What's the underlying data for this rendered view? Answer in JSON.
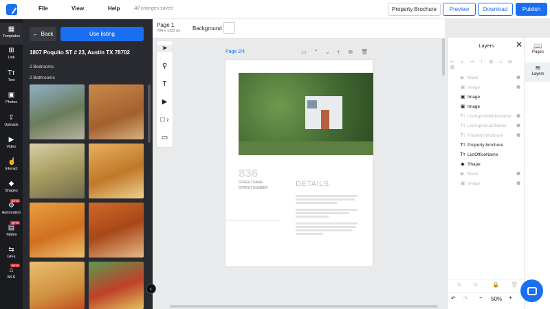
{
  "topbar": {
    "menus": [
      "File",
      "View",
      "Help"
    ],
    "saved": "All changes saved",
    "property_brochure": "Property Brochure",
    "preview": "Preview",
    "download": "Download",
    "publish": "Publish"
  },
  "rail": {
    "items": [
      "Templates",
      "Link",
      "Text",
      "Photos",
      "Uploads",
      "Video",
      "Interact",
      "Shapes",
      "Automation",
      "Tables",
      "GIFs",
      "MLS"
    ],
    "beta": "BETA"
  },
  "panel": {
    "back": "Back",
    "use_listing": "Use listing",
    "address": "1807 Poquito ST # 23, Austin TX 78702",
    "bedrooms": "2 Bedrooms",
    "bathrooms": "2 Bathrooms"
  },
  "subbar": {
    "page": "Page 1",
    "dims": "794 x 1123 px",
    "background": "Background"
  },
  "canvas": {
    "page_label": "Page 2/4",
    "street_number": "836",
    "street_name": "STREET NAME",
    "street_number_label": "STREET NUMBER",
    "details": "DETAILS"
  },
  "layers": {
    "title": "Layers",
    "items": [
      {
        "label": "Mask",
        "icon": "video-icon",
        "hidden": true
      },
      {
        "label": "Image",
        "icon": "image-icon",
        "hidden": true
      },
      {
        "label": "Image",
        "icon": "image-icon",
        "hidden": false
      },
      {
        "label": "Image",
        "icon": "image-icon",
        "hidden": false
      },
      {
        "label": "ListAgentMiddleName",
        "icon": "text-icon",
        "hidden": true
      },
      {
        "label": "ListAgentLastName",
        "icon": "text-icon",
        "hidden": true
      },
      {
        "label": "Property brochure",
        "icon": "text-icon",
        "hidden": true
      },
      {
        "label": "Property brochure",
        "icon": "text-icon",
        "hidden": false
      },
      {
        "label": "ListOfficeName",
        "icon": "text-icon",
        "hidden": false
      },
      {
        "label": "Shape",
        "icon": "shape-icon",
        "hidden": false
      },
      {
        "label": "Mask",
        "icon": "video-icon",
        "hidden": true
      },
      {
        "label": "Image",
        "icon": "image-icon",
        "hidden": true
      }
    ]
  },
  "tabs": {
    "pages": "Pages",
    "layers": "Layers"
  },
  "zoom": {
    "value": "50%"
  },
  "colors": {
    "accent": "#1a6ff0",
    "sidebar": "#1a1b1f",
    "panel": "#2a2b30"
  }
}
